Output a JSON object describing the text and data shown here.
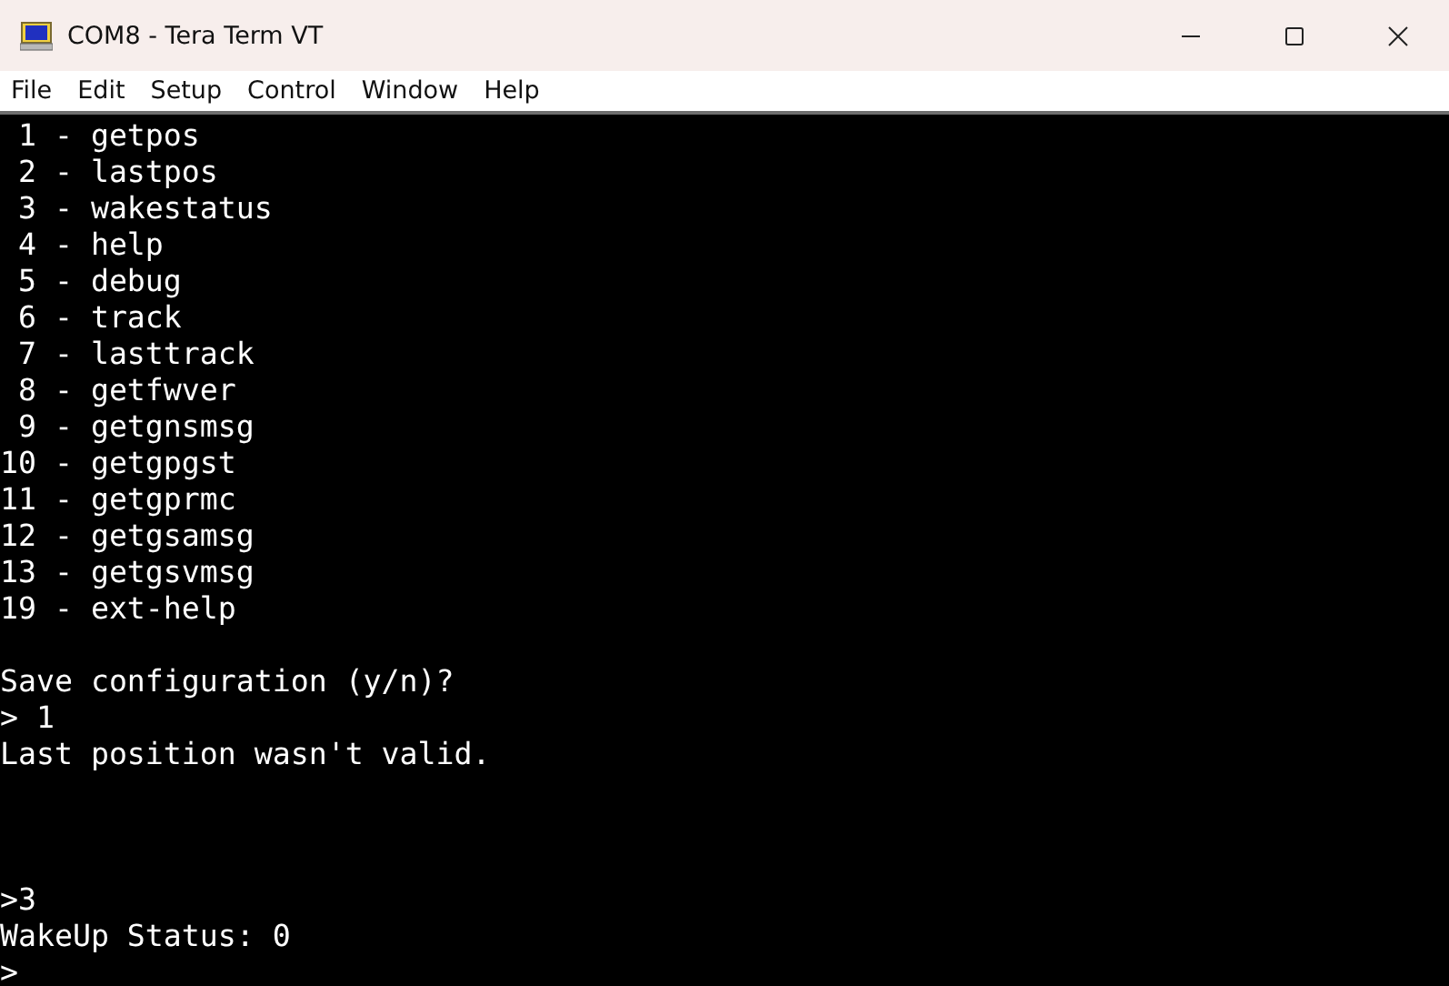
{
  "window": {
    "title": "COM8 - Tera Term VT"
  },
  "menu": [
    "File",
    "Edit",
    "Setup",
    "Control",
    "Window",
    "Help"
  ],
  "terminal": {
    "lines": [
      {
        "kind": "text",
        "text": " 1 - getpos"
      },
      {
        "kind": "text",
        "text": " 2 - lastpos"
      },
      {
        "kind": "text",
        "text": " 3 - wakestatus"
      },
      {
        "kind": "text",
        "text": " 4 - help"
      },
      {
        "kind": "text",
        "text": " 5 - debug"
      },
      {
        "kind": "text",
        "text": " 6 - track"
      },
      {
        "kind": "text",
        "text": " 7 - lasttrack"
      },
      {
        "kind": "text",
        "text": " 8 - getfwver"
      },
      {
        "kind": "text",
        "text": " 9 - getgnsmsg"
      },
      {
        "kind": "text",
        "text": "10 - getgpgst"
      },
      {
        "kind": "text",
        "text": "11 - getgprmc"
      },
      {
        "kind": "text",
        "text": "12 - getgsamsg"
      },
      {
        "kind": "text",
        "text": "13 - getgsvmsg"
      },
      {
        "kind": "text",
        "text": "19 - ext-help"
      },
      {
        "kind": "blank"
      },
      {
        "kind": "text",
        "text": "Save configuration (y/n)?"
      },
      {
        "kind": "text",
        "text": "> 1"
      },
      {
        "kind": "text",
        "text": "Last position wasn't valid."
      },
      {
        "kind": "blank"
      },
      {
        "kind": "blank"
      },
      {
        "kind": "blank"
      },
      {
        "kind": "text",
        "text": ">3"
      },
      {
        "kind": "text",
        "text": "WakeUp Status: 0"
      },
      {
        "kind": "text",
        "text": ">"
      }
    ]
  }
}
